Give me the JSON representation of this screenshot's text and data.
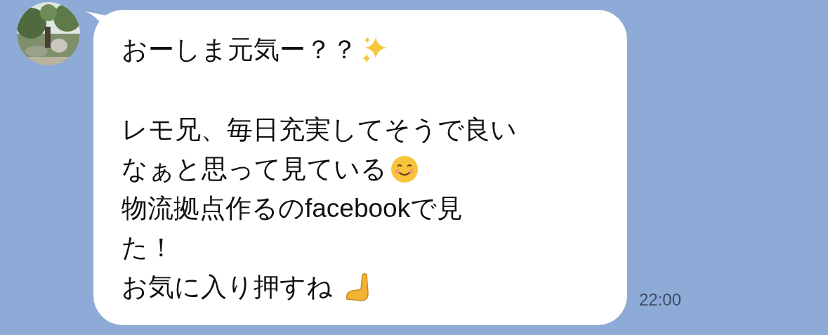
{
  "message": {
    "paragraphs": [
      [
        {
          "text": "おーしま元気ー？？",
          "kind": "sparkles"
        }
      ],
      [
        {
          "text": "レモ兄、毎日充実してそうで良い",
          "kind": "plain"
        },
        {
          "text": "なぁと思って見ている",
          "kind": "smile"
        },
        {
          "text": "物流拠点作るのfacebookで見",
          "kind": "plain"
        },
        {
          "text": "た！",
          "kind": "plain"
        },
        {
          "text": "お気に入り押すね ",
          "kind": "hand"
        }
      ]
    ],
    "time": "22:00"
  }
}
